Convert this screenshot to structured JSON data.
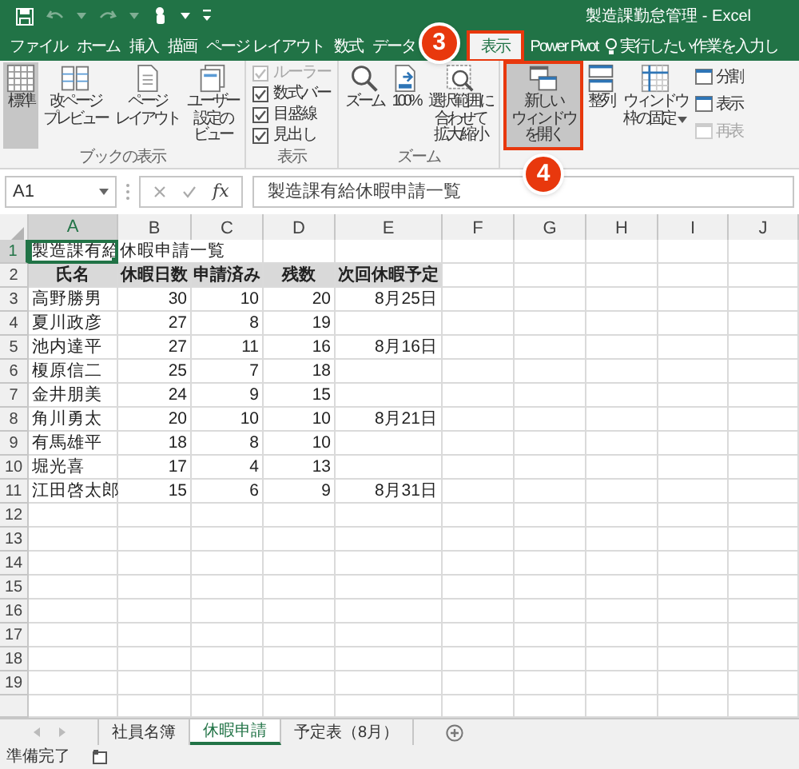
{
  "title_bar": {
    "title": "製造課勤怠管理 - Excel"
  },
  "ribbon_tabs": [
    {
      "label": "ファイル",
      "selected": false
    },
    {
      "label": "ホーム",
      "selected": false
    },
    {
      "label": "挿入",
      "selected": false
    },
    {
      "label": "描画",
      "selected": false
    },
    {
      "label": "ページ レイアウト",
      "selected": false
    },
    {
      "label": "数式",
      "selected": false
    },
    {
      "label": "データ",
      "selected": false
    },
    {
      "label": "表示",
      "selected": true,
      "highlighted": true,
      "annotation": "3"
    },
    {
      "label": "Power Pivot",
      "selected": false
    }
  ],
  "tell_me": {
    "placeholder": "実行したい作業を入力し"
  },
  "ribbon_groups": [
    {
      "label": "ブックの表示",
      "items": [
        {
          "kind": "large",
          "lines": [
            "標準"
          ],
          "selected": true
        },
        {
          "kind": "large",
          "lines": [
            "改ページ",
            "プレビュー"
          ],
          "selected": false
        },
        {
          "kind": "large",
          "lines": [
            "ページ",
            "レイアウト"
          ],
          "selected": false
        },
        {
          "kind": "large",
          "lines": [
            "ユーザー",
            "設定の",
            "ビュー"
          ],
          "selected": false
        }
      ]
    },
    {
      "label": "表示",
      "items": [
        {
          "kind": "checkbox",
          "label": "ルーラー",
          "checked": true,
          "disabled": true
        },
        {
          "kind": "checkbox",
          "label": "数式バー",
          "checked": true,
          "disabled": false
        },
        {
          "kind": "checkbox",
          "label": "目盛線",
          "checked": true,
          "disabled": false
        },
        {
          "kind": "checkbox",
          "label": "見出し",
          "checked": true,
          "disabled": false
        }
      ]
    },
    {
      "label": "ズーム",
      "items": [
        {
          "kind": "large",
          "lines": [
            "ズーム"
          ]
        },
        {
          "kind": "large",
          "lines": [
            "100%"
          ]
        },
        {
          "kind": "large",
          "lines": [
            "選択範囲に",
            "合わせて",
            "拡大/縮小"
          ]
        }
      ]
    },
    {
      "items": [
        {
          "kind": "large",
          "lines": [
            "新しい",
            "ウィンドウ",
            "を開く"
          ],
          "highlighted": true,
          "annotation": "4"
        },
        {
          "kind": "large",
          "lines": [
            "整列"
          ],
          "highlighted": false
        },
        {
          "kind": "large",
          "lines": [
            "ウィンドウ",
            "枠の固定"
          ],
          "dropdown": true,
          "highlighted": false
        },
        {
          "kind": "small",
          "label": "分割",
          "disabled": false
        },
        {
          "kind": "small",
          "label": "表示",
          "disabled": false
        },
        {
          "kind": "small",
          "label": "再表",
          "disabled": true
        }
      ]
    }
  ],
  "formula_bar": {
    "name_box": "A1",
    "function_label": "fx",
    "value": "製造課有給休暇申請一覧"
  },
  "sheet": {
    "columns": [
      {
        "label": "A",
        "selected": true
      },
      {
        "label": "B",
        "selected": false
      },
      {
        "label": "C",
        "selected": false
      },
      {
        "label": "D",
        "selected": false
      },
      {
        "label": "E",
        "selected": false
      },
      {
        "label": "F",
        "selected": false
      },
      {
        "label": "G",
        "selected": false
      },
      {
        "label": "H",
        "selected": false
      },
      {
        "label": "I",
        "selected": false
      },
      {
        "label": "J",
        "selected": false
      }
    ],
    "rows": [
      {
        "number": "1",
        "selected": true,
        "kind": "title",
        "cells": [
          "製造課有給休暇申請一覧"
        ]
      },
      {
        "number": "2",
        "selected": false,
        "kind": "header",
        "cells": [
          "氏名",
          "休暇日数",
          "申請済み",
          "残数",
          "次回休暇予定"
        ]
      },
      {
        "number": "3",
        "selected": false,
        "kind": "data",
        "cells": [
          "高野勝男",
          "30",
          "10",
          "20",
          "8月25日"
        ]
      },
      {
        "number": "4",
        "selected": false,
        "kind": "data",
        "cells": [
          "夏川政彦",
          "27",
          "8",
          "19"
        ]
      },
      {
        "number": "5",
        "selected": false,
        "kind": "data",
        "cells": [
          "池内達平",
          "27",
          "11",
          "16",
          "8月16日"
        ]
      },
      {
        "number": "6",
        "selected": false,
        "kind": "data",
        "cells": [
          "榎原信二",
          "25",
          "7",
          "18"
        ]
      },
      {
        "number": "7",
        "selected": false,
        "kind": "data",
        "cells": [
          "金井朋美",
          "24",
          "9",
          "15"
        ]
      },
      {
        "number": "8",
        "selected": false,
        "kind": "data",
        "cells": [
          "角川勇太",
          "20",
          "10",
          "10",
          "8月21日"
        ]
      },
      {
        "number": "9",
        "selected": false,
        "kind": "data",
        "cells": [
          "有馬雄平",
          "18",
          "8",
          "10"
        ]
      },
      {
        "number": "10",
        "selected": false,
        "kind": "data",
        "cells": [
          "堀光喜",
          "17",
          "4",
          "13"
        ]
      },
      {
        "number": "11",
        "selected": false,
        "kind": "data",
        "cells": [
          "江田啓太郎",
          "15",
          "6",
          "9",
          "8月31日"
        ]
      },
      {
        "number": "12",
        "selected": false,
        "kind": "data"
      },
      {
        "number": "13",
        "selected": false,
        "kind": "data"
      },
      {
        "number": "14",
        "selected": false,
        "kind": "data"
      },
      {
        "number": "15",
        "selected": false,
        "kind": "data"
      },
      {
        "number": "16",
        "selected": false,
        "kind": "data"
      },
      {
        "number": "17",
        "selected": false,
        "kind": "data"
      },
      {
        "number": "18",
        "selected": false,
        "kind": "data"
      },
      {
        "number": "19",
        "selected": false,
        "kind": "data"
      }
    ]
  },
  "sheet_tabs": [
    {
      "label": "社員名簿",
      "selected": false
    },
    {
      "label": "休暇申請",
      "selected": true
    },
    {
      "label": "予定表（8月）",
      "selected": false
    }
  ],
  "status_bar": {
    "text": "準備完了"
  }
}
